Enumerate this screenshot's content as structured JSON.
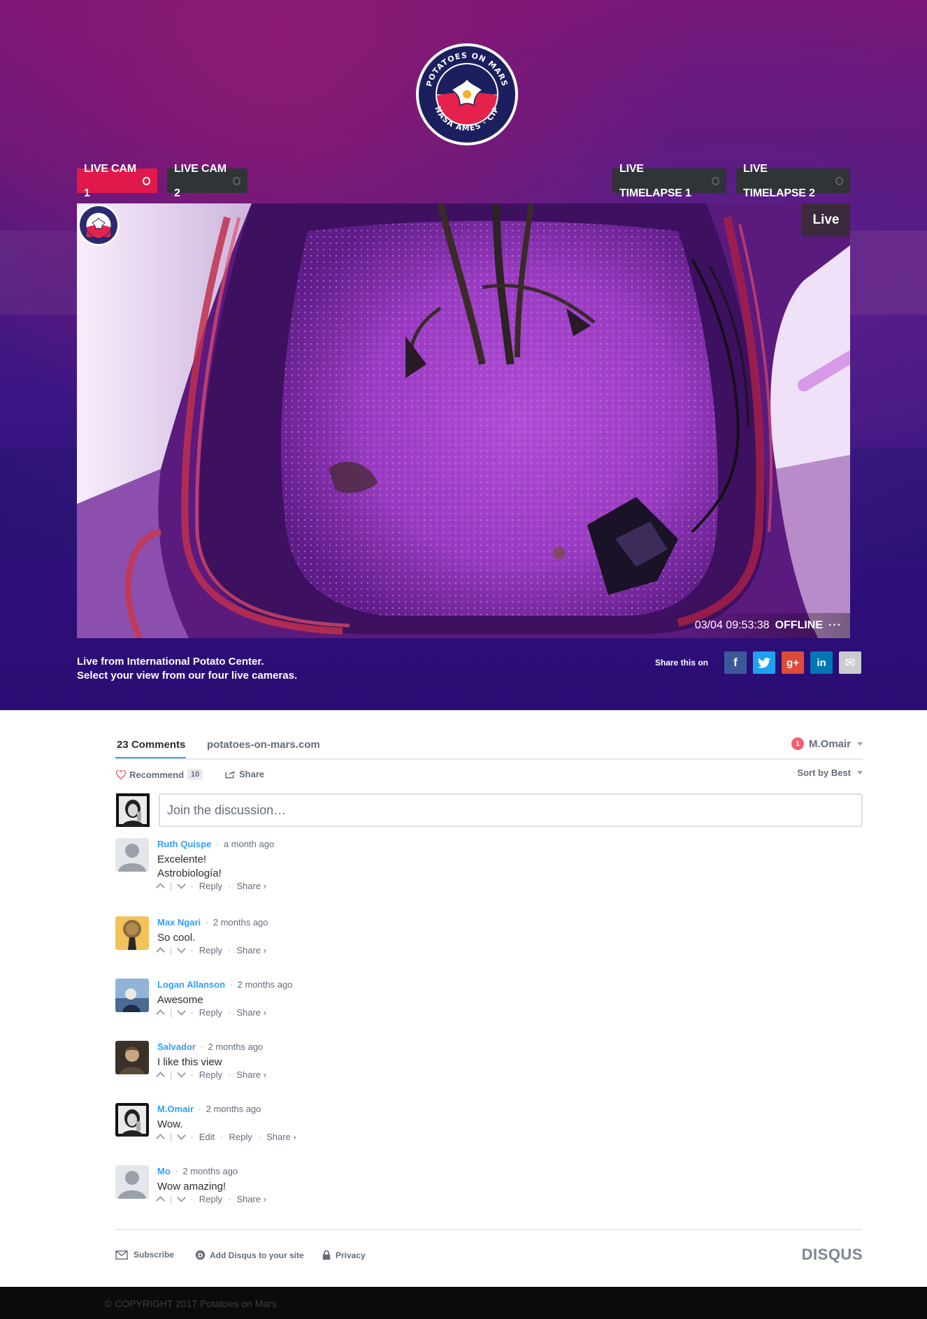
{
  "brand": {
    "logo_top_text": "POTATOES ON MARS",
    "logo_bottom_text": "NASA AMES · CIP"
  },
  "cam_tabs": [
    {
      "label": "LIVE CAM 1",
      "active": true
    },
    {
      "label": "LIVE CAM 2",
      "active": false
    },
    {
      "label": "LIVE TIMELAPSE 1",
      "active": false
    },
    {
      "label": "LIVE TIMELAPSE 2",
      "active": false
    }
  ],
  "video": {
    "live_label": "Live",
    "timestamp": "03/04 09:53:38",
    "status": "OFFLINE",
    "more": "···"
  },
  "caption": {
    "line1": "Live from International Potato Center.",
    "line2": "Select your view from our four live cameras."
  },
  "share": {
    "label": "Share this on",
    "buttons": [
      {
        "name": "facebook",
        "glyph": "f",
        "color": "#3b5998"
      },
      {
        "name": "twitter",
        "glyph": "t",
        "color": "#1da1f2"
      },
      {
        "name": "google-plus",
        "glyph": "g+",
        "color": "#dd4b39"
      },
      {
        "name": "linkedin",
        "glyph": "in",
        "color": "#0077b5"
      },
      {
        "name": "email",
        "glyph": "✉",
        "color": "#c9ccd0"
      }
    ]
  },
  "disqus": {
    "comment_count": "23 Comments",
    "site": "potatoes-on-mars.com",
    "user": "M.Omair",
    "notifications": "1",
    "recommend_label": "Recommend",
    "recommend_count": "10",
    "share_label": "Share",
    "sort_label": "Sort by Best",
    "composer_placeholder": "Join the discussion…",
    "comments": [
      {
        "author": "Ruth Quispe",
        "time": "a month ago",
        "lines": [
          "Excelente!",
          "Astrobiología!"
        ],
        "actions": [
          "Reply",
          "Share ›"
        ]
      },
      {
        "author": "Max Ngari",
        "time": "2 months ago",
        "lines": [
          "So cool."
        ],
        "actions": [
          "Reply",
          "Share ›"
        ]
      },
      {
        "author": "Logan Allanson",
        "time": "2 months ago",
        "lines": [
          "Awesome"
        ],
        "actions": [
          "Reply",
          "Share ›"
        ]
      },
      {
        "author": "Salvador",
        "time": "2 months ago",
        "lines": [
          "I like this view"
        ],
        "actions": [
          "Reply",
          "Share ›"
        ]
      },
      {
        "author": "M.Omair",
        "time": "2 months ago",
        "lines": [
          "Wow."
        ],
        "actions": [
          "Edit",
          "Reply",
          "Share ›"
        ]
      },
      {
        "author": "Mo",
        "time": "2 months ago",
        "lines": [
          "Wow amazing!"
        ],
        "actions": [
          "Reply",
          "Share ›"
        ]
      }
    ],
    "footer": {
      "subscribe": "Subscribe",
      "add_disqus": "Add Disqus to your site",
      "privacy": "Privacy",
      "brand": "DISQUS"
    }
  },
  "copyright": "© COPYRIGHT 2017 Potatoes on Mars"
}
